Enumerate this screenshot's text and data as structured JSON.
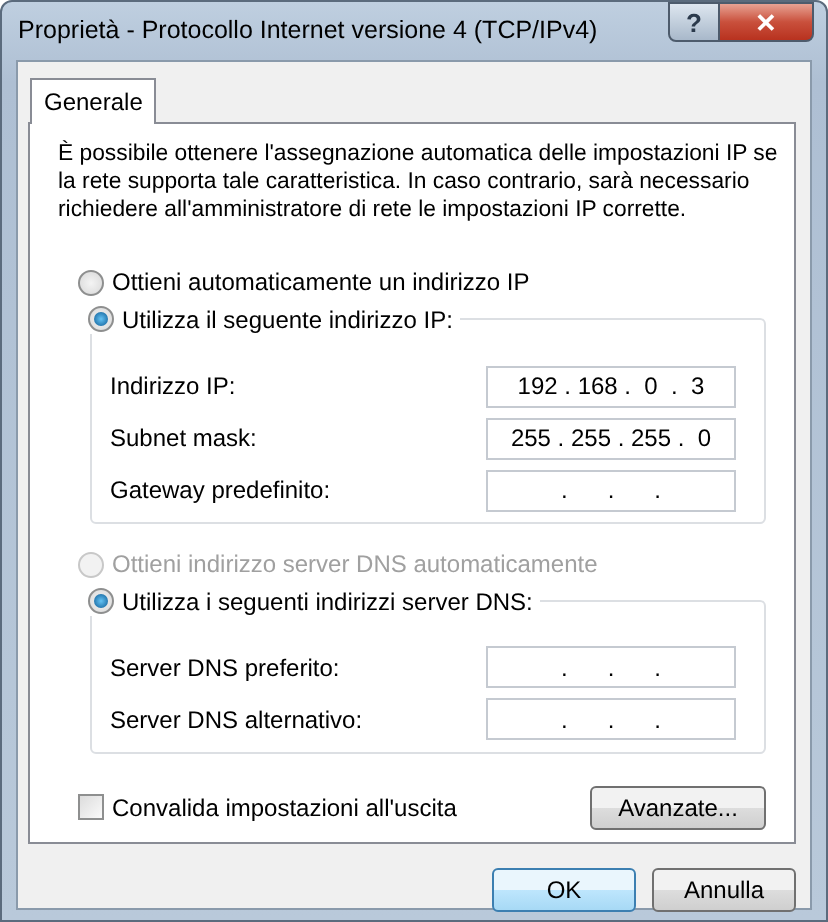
{
  "window": {
    "title": "Proprietà - Protocollo Internet versione 4 (TCP/IPv4)",
    "title_buttons": [
      {
        "kind": "help",
        "label": "?"
      },
      {
        "kind": "close",
        "label": "✕"
      }
    ]
  },
  "tabs": [
    {
      "label": "Generale",
      "selected": true
    }
  ],
  "intro": "È possibile ottenere l'assegnazione automatica delle impostazioni IP se la rete supporta tale caratteristica. In caso contrario, sarà necessario richiedere all'amministratore di rete le impostazioni IP corrette.",
  "ip_options": [
    {
      "label": "Ottieni automaticamente un indirizzo IP",
      "selected": false,
      "disabled": false
    },
    {
      "label": "Utilizza il seguente indirizzo IP:",
      "selected": true,
      "disabled": false,
      "fields": [
        {
          "label": "Indirizzo IP:",
          "value": "192 . 168 .  0  .  3"
        },
        {
          "label": "Subnet mask:",
          "value": "255 . 255 . 255 .  0"
        },
        {
          "label": "Gateway predefinito:",
          "value": ".      .      ."
        }
      ]
    }
  ],
  "dns_options": [
    {
      "label": "Ottieni indirizzo server DNS automaticamente",
      "selected": false,
      "disabled": true
    },
    {
      "label": "Utilizza i seguenti indirizzi server DNS:",
      "selected": true,
      "disabled": false,
      "fields": [
        {
          "label": "Server DNS preferito:",
          "value": ".      .      ."
        },
        {
          "label": "Server DNS alternativo:",
          "value": ".      .      ."
        }
      ]
    }
  ],
  "validate": {
    "label": "Convalida impostazioni all'uscita",
    "checked": false
  },
  "advanced_button": "Avanzate...",
  "buttons": [
    {
      "label": "OK",
      "default": true
    },
    {
      "label": "Annulla",
      "default": false
    }
  ]
}
